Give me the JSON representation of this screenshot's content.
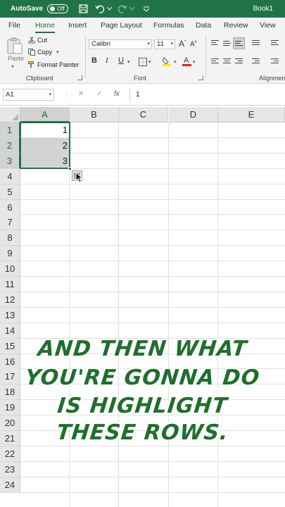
{
  "titlebar": {
    "autosave_label": "AutoSave",
    "autosave_state": "Off",
    "book_name": "Book1",
    "bg_color": "#217346"
  },
  "tabs": [
    {
      "label": "File"
    },
    {
      "label": "Home"
    },
    {
      "label": "Insert"
    },
    {
      "label": "Page Layout"
    },
    {
      "label": "Formulas"
    },
    {
      "label": "Data"
    },
    {
      "label": "Review"
    },
    {
      "label": "View"
    }
  ],
  "ribbon": {
    "clipboard": {
      "paste": "Paste",
      "cut": "Cut",
      "copy": "Copy",
      "format_painter": "Format Painter",
      "group": "Clipboard"
    },
    "font": {
      "name": "Calibri",
      "size": "11",
      "bold": "B",
      "italic": "I",
      "underline": "U",
      "group": "Font",
      "font_color": "#e02020",
      "fill_color": "#ffe600"
    },
    "alignment": {
      "group": "Alignment"
    }
  },
  "formula_bar": {
    "name_box": "A1",
    "cancel": "✕",
    "enter": "✓",
    "fx": "fx",
    "value": "1"
  },
  "grid": {
    "columns": [
      "A",
      "B",
      "C",
      "D",
      "E"
    ],
    "rows": [
      "1",
      "2",
      "3",
      "4",
      "5",
      "6",
      "7",
      "8",
      "9",
      "10",
      "11",
      "12",
      "13",
      "14",
      "15",
      "16",
      "17",
      "18",
      "19",
      "20",
      "21",
      "22",
      "23",
      "24"
    ],
    "cells": {
      "A1": "1",
      "A2": "2",
      "A3": "3"
    }
  },
  "caption": {
    "lines": [
      "And then what",
      "you're gonna do",
      "is highlight",
      "these rows."
    ],
    "color": "#1f6f2c"
  }
}
